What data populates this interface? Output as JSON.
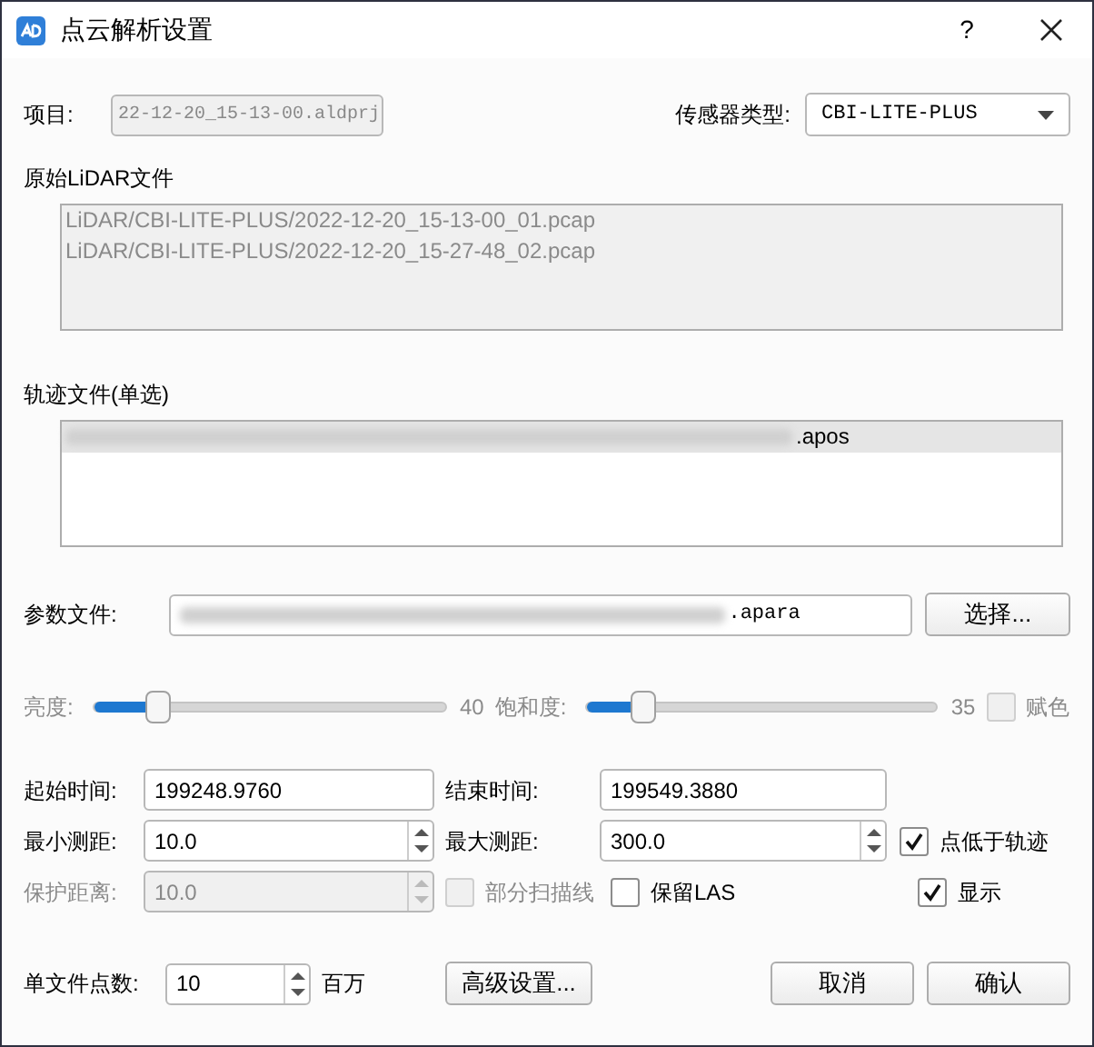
{
  "window": {
    "title": "点云解析设置",
    "help": "?"
  },
  "project": {
    "label": "项目:",
    "value": "22-12-20_15-13-00.aldprj",
    "disabled": true
  },
  "sensor_type": {
    "label": "传感器类型:",
    "value": "CBI-LITE-PLUS"
  },
  "raw_lidar": {
    "label": "原始LiDAR文件",
    "disabled": true,
    "files": [
      {
        "text": "LiDAR/CBI-LITE-PLUS/2022-12-20_15-13-00_01.pcap"
      },
      {
        "text": "LiDAR/CBI-LITE-PLUS/2022-12-20_15-27-48_02.pcap"
      }
    ]
  },
  "trajectory": {
    "label": "轨迹文件(单选)",
    "files": [
      {
        "text": ".apos",
        "blurred_prefix": true,
        "selected": true
      }
    ]
  },
  "param_file": {
    "label": "参数文件:",
    "value": ".apara",
    "blurred_prefix": true,
    "button": "选择..."
  },
  "brightness": {
    "label": "亮度:",
    "level": 0.18,
    "reading": "40",
    "disabled": true
  },
  "saturation": {
    "label": "饱和度:",
    "level": 0.16,
    "reading": "35",
    "disabled": true
  },
  "false_color": {
    "label": "赋色",
    "checked": false,
    "disabled": true
  },
  "start_time": {
    "label": "起始时间:",
    "value": "199248.9760"
  },
  "end_time": {
    "label": "结束时间:",
    "value": "199549.3880"
  },
  "min_range": {
    "label": "最小测距:",
    "value": "10.0",
    "disabled": false
  },
  "max_range": {
    "label": "最大测距:",
    "value": "300.0",
    "disabled": false
  },
  "below_track": {
    "label": "点低于轨迹",
    "checked": true,
    "disabled": false
  },
  "guard_distance": {
    "label": "保护距离:",
    "value": "10.0",
    "disabled": true
  },
  "partial_scanlines": {
    "label": "部分扫描线",
    "checked": false,
    "disabled": true
  },
  "keep_las": {
    "label": "保留LAS",
    "checked": false,
    "disabled": false
  },
  "show": {
    "label": "显示",
    "checked": true,
    "disabled": false
  },
  "points_per_file": {
    "label": "单文件点数:",
    "value": "10",
    "unit": "百万"
  },
  "advanced_button": "高级设置...",
  "buttons": [
    "取消",
    "确认"
  ]
}
